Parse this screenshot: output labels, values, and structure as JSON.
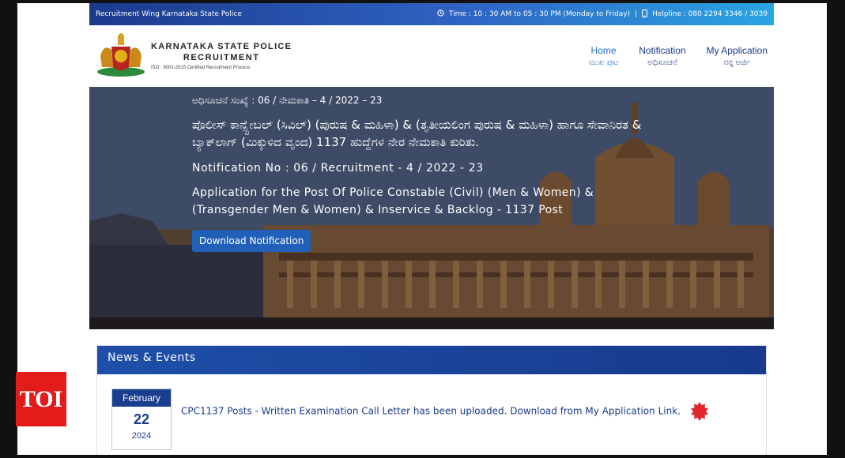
{
  "topbar": {
    "left": "Recruitment Wing Karnataka State Police",
    "time": "Time : 10 : 30 AM to 05 : 30 PM (Monday to Friday)",
    "separator": "|",
    "helpline": "Helpline : 080 2294 3346 / 3039"
  },
  "brand": {
    "line1": "KARNATAKA STATE POLICE",
    "line2": "RECRUITMENT",
    "line3": "ISO : 9001-2015 Certified Recruitment Process"
  },
  "nav": [
    {
      "en": "Home",
      "kn": "ಮುಖ ಪುಟ"
    },
    {
      "en": "Notification",
      "kn": "ಅಧಿಸೂಚನೆ"
    },
    {
      "en": "My Application",
      "kn": "ನನ್ನ ಅರ್ಜಿ"
    }
  ],
  "hero": {
    "kn_no": "ಅಧಿಸೂಚನೆ ಸಂಖ್ಯೆ : 06 / ನೇಮಕಾತಿ – 4 / 2022 – 23",
    "kn_title": "ಪೊಲೀಸ್ ಕಾನ್ಸ್ಟೇಬಲ್ (ಸಿವಿಲ್) (ಪುರುಷ & ಮಹಿಳಾ) & (ತೃತೀಯಲಿಂಗ ಪುರುಷ & ಮಹಿಳಾ) ಹಾಗೂ ಸೇವಾನಿರತ & ಬ್ಯಾಕ್‌ಲಾಗ್ (ಮಿಕ್ಕುಳಿದ ವೃಂದ) 1137 ಹುದ್ದೆಗಳ ನೇರ ನೇಮಕಾತಿ ಕುರಿತು.",
    "en_no": "Notification No : 06 / Recruitment - 4 / 2022 - 23",
    "en_title": "Application for the Post Of Police Constable (Civil) (Men & Women) & (Transgender Men & Women) & Inservice & Backlog - 1137 Post",
    "button": "Download Notification"
  },
  "news": {
    "header": "News & Events",
    "items": [
      {
        "month": "February",
        "day": "22",
        "year": "2024",
        "text": "CPC1137 Posts - Written Examination Call Letter has been uploaded. Download from My Application Link."
      }
    ]
  },
  "watermark": "TOI"
}
